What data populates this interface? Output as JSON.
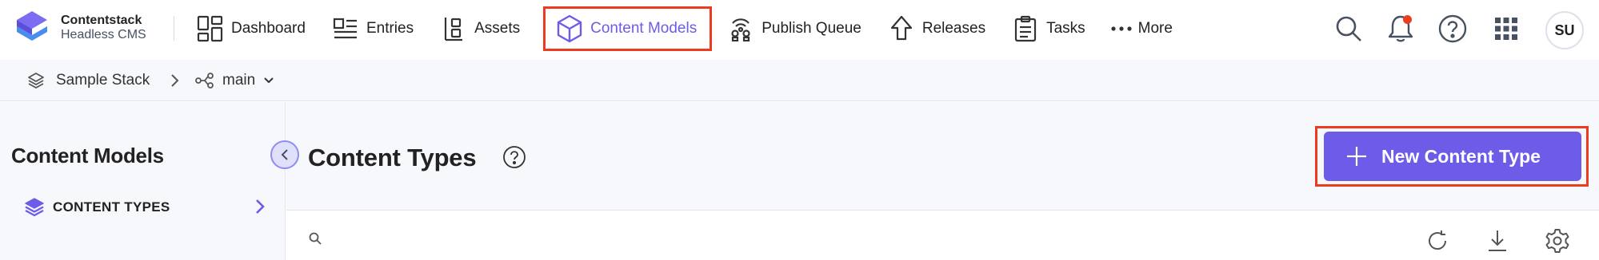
{
  "brand": {
    "name": "Contentstack",
    "subtitle": "Headless CMS",
    "logo_icon": "contentstack-logo"
  },
  "nav": {
    "items": [
      {
        "label": "Dashboard",
        "icon": "dashboard-icon"
      },
      {
        "label": "Entries",
        "icon": "entries-icon"
      },
      {
        "label": "Assets",
        "icon": "assets-icon"
      },
      {
        "label": "Content Models",
        "icon": "content-models-cube-icon",
        "active": true
      },
      {
        "label": "Publish Queue",
        "icon": "publish-queue-icon"
      },
      {
        "label": "Releases",
        "icon": "releases-icon"
      },
      {
        "label": "Tasks",
        "icon": "tasks-clipboard-icon"
      },
      {
        "label": "More",
        "icon": "more-dots-icon"
      }
    ]
  },
  "header_icons": [
    "search-icon",
    "notification-bell-icon",
    "help-icon",
    "apps-grid-icon"
  ],
  "user": {
    "initials": "SU"
  },
  "breadcrumb": {
    "stack": "Sample Stack",
    "branch": "main"
  },
  "sidebar": {
    "title": "Content Models",
    "items": [
      {
        "label": "CONTENT TYPES",
        "icon": "content-types-layers-icon"
      }
    ]
  },
  "main": {
    "title": "Content Types",
    "new_button_label": "New Content Type",
    "search_placeholder": ""
  },
  "colors": {
    "accent": "#6c5ce7",
    "highlight_outline": "#ec3b1e",
    "notification": "#e8401f",
    "panel_bg": "#f7f8fc"
  }
}
